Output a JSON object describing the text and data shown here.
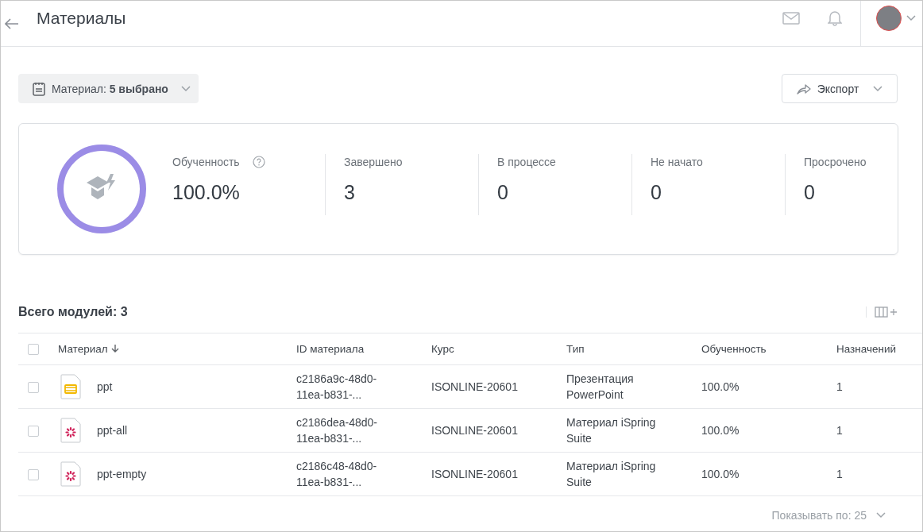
{
  "header": {
    "title": "Материалы"
  },
  "filter": {
    "label": "Материал: **5 выбрано**"
  },
  "export": {
    "label": "Экспорт"
  },
  "summary": {
    "stats": [
      {
        "label": "Обученность",
        "value": "100.0%",
        "kind": "with_help"
      },
      {
        "label": "Завершено",
        "value": "3",
        "kind": "plain"
      },
      {
        "label": "В процессе",
        "value": "0",
        "kind": "plain"
      },
      {
        "label": "Не начато",
        "value": "0",
        "kind": "plain"
      },
      {
        "label": "Просрочено",
        "value": "0",
        "kind": "plain"
      }
    ]
  },
  "table": {
    "total": "Всего модулей: 3",
    "select_all_checked": false,
    "columns": [
      "Материал",
      "ID материала",
      "Курс",
      "Тип",
      "Обученность",
      "Назначений"
    ],
    "rows": [
      {
        "checked": false,
        "kind": "presentation",
        "name": "ppt",
        "id": "c2186a9c-48d0-11ea-b831-...",
        "course": "ISONLINE-20601",
        "type": "Презентация PowerPoint",
        "progress": "100.0%",
        "assignments": "1"
      },
      {
        "checked": false,
        "kind": "ispring",
        "name": "ppt-all",
        "id": "c2186dea-48d0-11ea-b831-...",
        "course": "ISONLINE-20601",
        "type": "Материал iSpring Suite",
        "progress": "100.0%",
        "assignments": "1"
      },
      {
        "checked": false,
        "kind": "ispring",
        "name": "ppt-empty",
        "id": "c2186c48-48d0-11ea-b831-...",
        "course": "ISONLINE-20601",
        "type": "Материал iSpring Suite",
        "progress": "100.0%",
        "assignments": "1"
      }
    ]
  },
  "pager": {
    "label": "Показывать по: 25"
  }
}
